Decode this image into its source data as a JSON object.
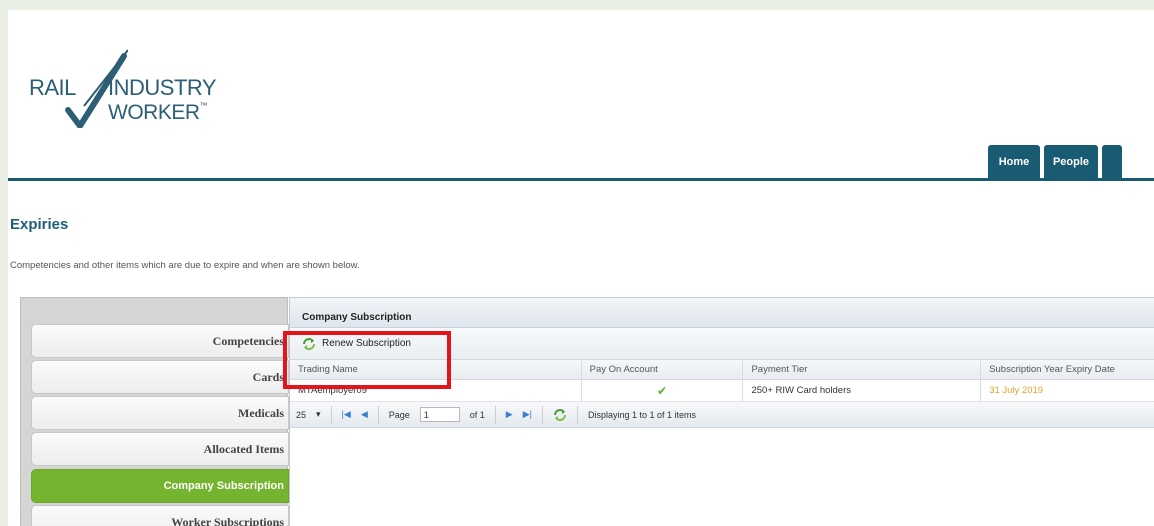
{
  "logo": {
    "line1a": "RAIL",
    "line1b": "INDUSTRY",
    "line2": "WORKER",
    "tm": "™"
  },
  "nav": {
    "tabs": [
      "Home",
      "People",
      ""
    ]
  },
  "page": {
    "title": "Expiries",
    "description": "Competencies and other items which are due to expire and when are shown below."
  },
  "menu": {
    "items": [
      "Competencies",
      "Cards",
      "Medicals",
      "Allocated Items",
      "Company Subscription",
      "Worker Subscriptions"
    ],
    "active": "Company Subscription"
  },
  "grid": {
    "title": "Company Subscription",
    "toolbar": {
      "renew_label": "Renew Subscription",
      "renew_icon": "refresh-icon"
    },
    "columns": [
      "Trading Name",
      "Pay On Account",
      "Payment Tier",
      "Subscription Year Expiry Date"
    ],
    "rows": [
      {
        "trading_name": "MTAemployer09",
        "pay_on_account": "✔",
        "payment_tier": "250+ RIW Card holders",
        "expiry_date": "31 July 2019"
      }
    ],
    "pager": {
      "page_size": "25",
      "page_label": "Page",
      "page_value": "1",
      "of_label": "of 1",
      "status": "Displaying 1 to 1 of 1 items"
    }
  },
  "colors": {
    "brand": "#1a5b74",
    "active_menu": "#74b42e",
    "highlight": "#e4141b",
    "expiry": "#e5a12c"
  }
}
